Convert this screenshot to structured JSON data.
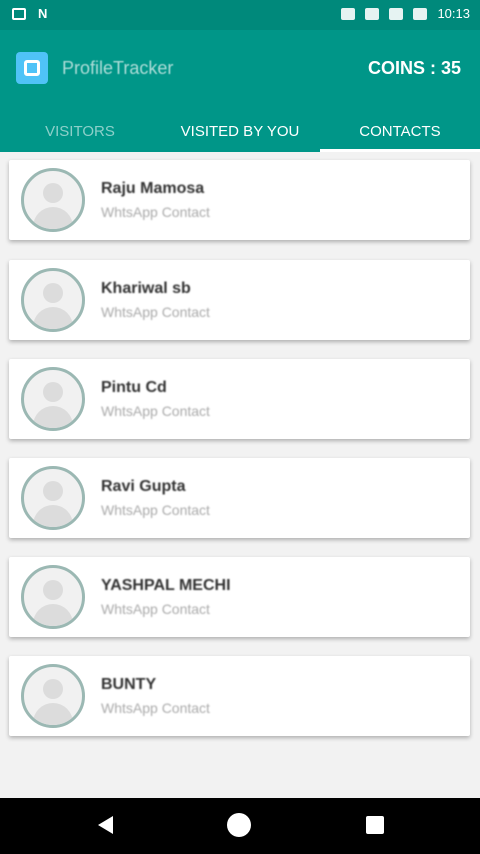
{
  "status_bar": {
    "time": "10:13"
  },
  "app": {
    "title": "ProfileTracker",
    "coins": "COINS : 35"
  },
  "tabs": [
    {
      "label": "VISITORS"
    },
    {
      "label": "VISITED BY YOU"
    },
    {
      "label": "CONTACTS"
    }
  ],
  "contacts": [
    {
      "name": "Raju Mamosa",
      "subtitle": "WhtsApp Contact"
    },
    {
      "name": "Khariwal sb",
      "subtitle": "WhtsApp Contact"
    },
    {
      "name": "Pintu Cd",
      "subtitle": "WhtsApp Contact"
    },
    {
      "name": "Ravi Gupta",
      "subtitle": "WhtsApp Contact"
    },
    {
      "name": "YASHPAL MECHI",
      "subtitle": "WhtsApp Contact"
    },
    {
      "name": "BUNTY",
      "subtitle": "WhtsApp Contact"
    }
  ]
}
